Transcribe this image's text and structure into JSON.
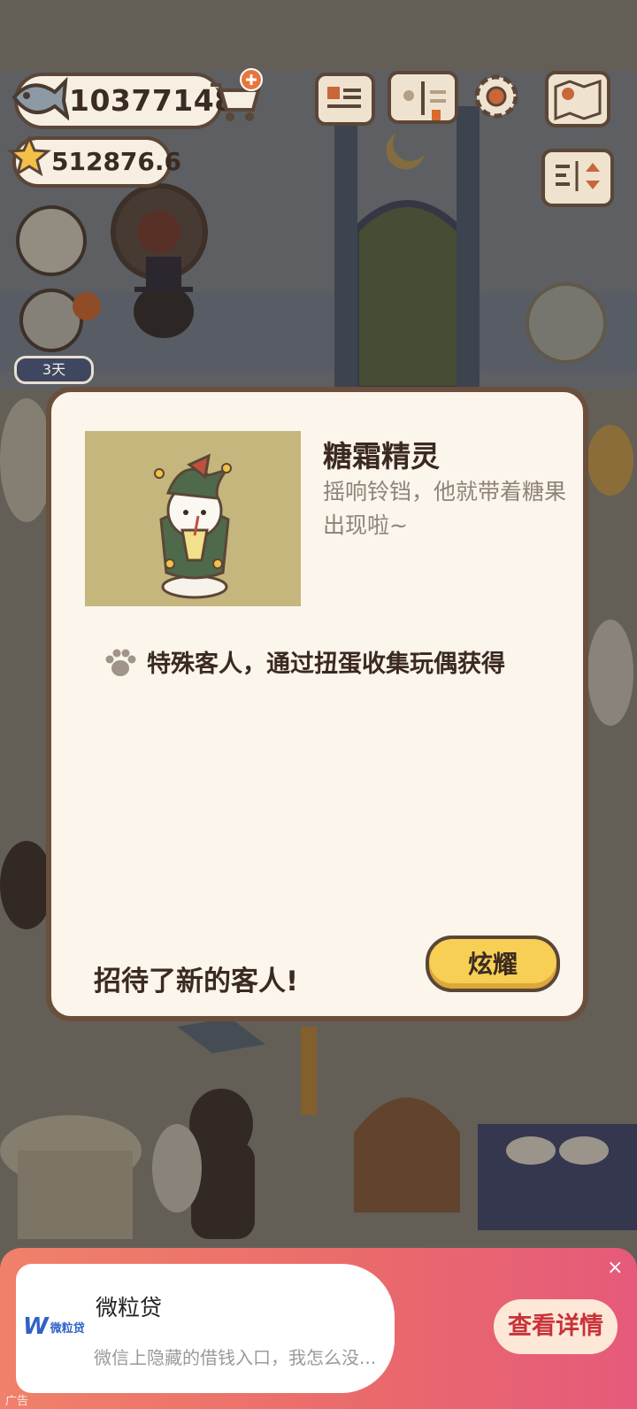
{
  "hud": {
    "fish_count": "10377148",
    "star_count": "512876.6",
    "days_badge": "3天",
    "icons": [
      "fish-icon",
      "cart-add-icon",
      "star-icon",
      "profile-card-icon",
      "catalog-book-icon",
      "settings-gear-icon",
      "map-icon",
      "sort-toggle-icon"
    ]
  },
  "modal": {
    "title": "糖霜精灵",
    "description": "摇响铃铛，他就带着糖果出现啦~",
    "hint": "特殊客人，通过扭蛋收集玩偶获得",
    "footer_text": "招待了新的客人!",
    "button_label": "炫耀"
  },
  "ad": {
    "logo_mark": "W",
    "logo_text": "微粒贷",
    "title": "微粒贷",
    "subtitle": "微信上隐藏的借钱入口，我怎么没...",
    "cta": "查看详情",
    "close": "×",
    "tag": "广告"
  },
  "colors": {
    "accent_yellow": "#f7cf55",
    "frame_brown": "#6b4f3d",
    "modal_bg": "#fbf5ec",
    "ad_red": "#ea6b6b"
  }
}
